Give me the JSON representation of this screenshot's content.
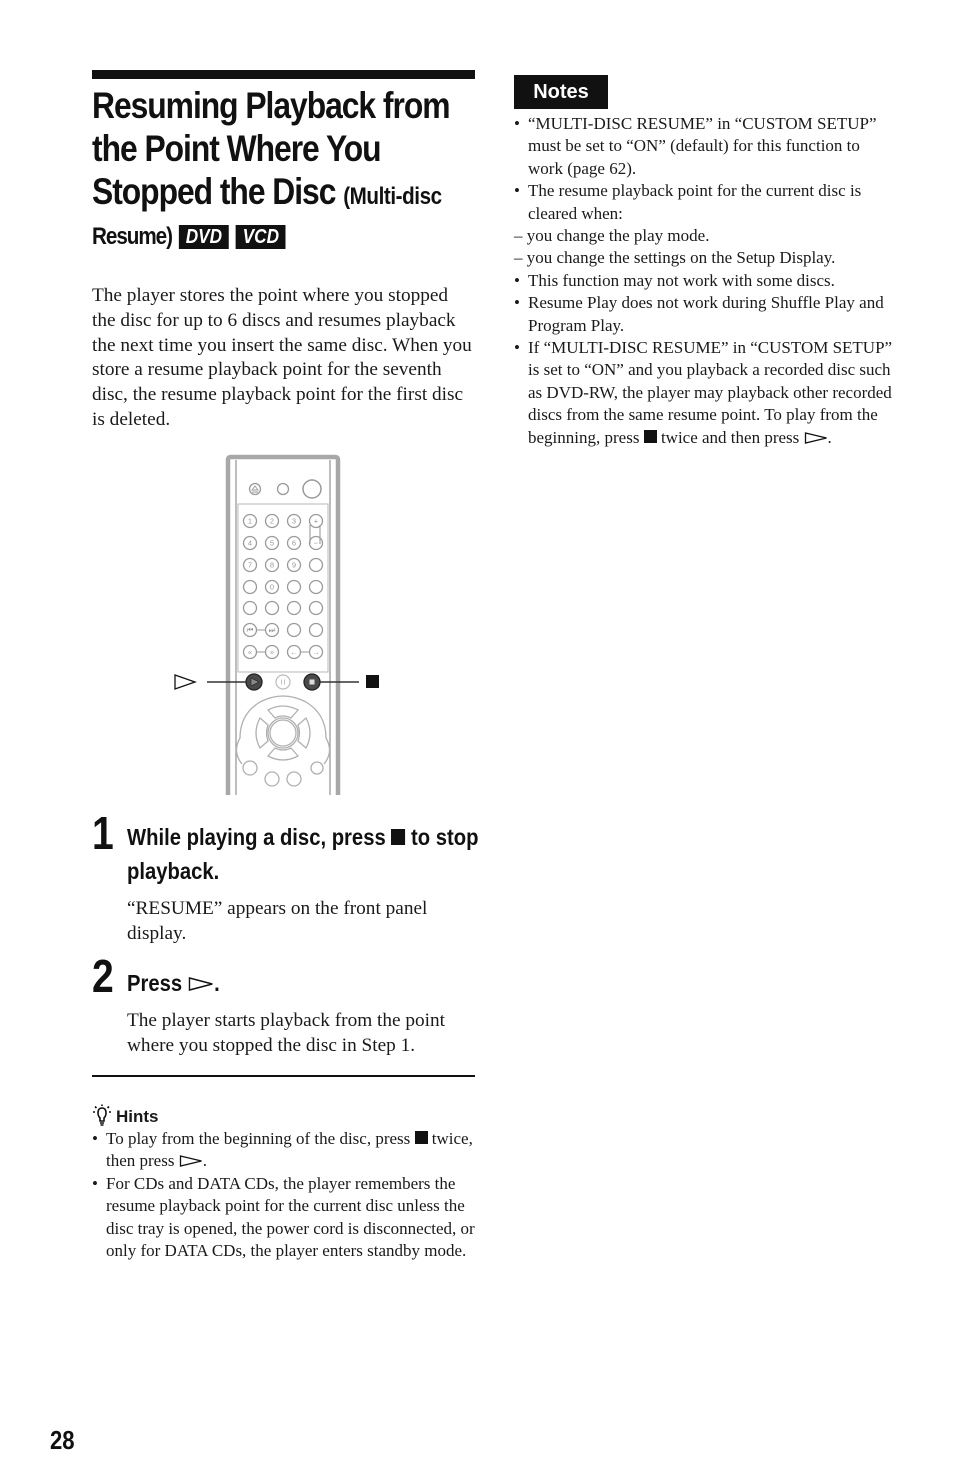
{
  "page": {
    "number": "28"
  },
  "title": {
    "line1": "Resuming Playback from",
    "line2": "the Point Where You",
    "line3_main": "Stopped the Disc",
    "line3_sub": "(Multi-disc",
    "line4_sub": "Resume)",
    "badges": [
      "DVD",
      "VCD"
    ]
  },
  "intro": "The player stores the point where you stopped the disc for up to 6 discs and resumes playback the next time you insert the same disc. When you store a resume playback point for the seventh disc, the resume playback point for the first disc is deleted.",
  "illustration": {
    "icons": [
      "remote-control",
      "play-button-callout",
      "stop-button-callout"
    ]
  },
  "steps": [
    {
      "number": "1",
      "heading_before": "While playing a disc, press",
      "heading_icon": "stop-icon",
      "heading_after": "to stop playback.",
      "body": "“RESUME” appears on the front panel display."
    },
    {
      "number": "2",
      "heading_before": "Press",
      "heading_icon": "play-icon",
      "heading_after": ".",
      "body": "The player starts playback from the point where you stopped the disc in Step 1."
    }
  ],
  "hints": {
    "title": "Hints",
    "items": [
      {
        "type": "bullet",
        "before": "To play from the beginning of the disc, press",
        "middle": "twice, then press",
        "after": "."
      },
      {
        "type": "bullet",
        "text": "For CDs and DATA CDs, the player remembers the resume playback point for the current disc unless the disc tray is opened, the power cord is disconnected, or only for DATA CDs, the player enters standby mode."
      }
    ]
  },
  "notes": {
    "title": "Notes",
    "items": [
      {
        "type": "bullet",
        "text": "“MULTI-DISC RESUME” in “CUSTOM SETUP” must be set to “ON” (default) for this function to work (page 62)."
      },
      {
        "type": "bullet",
        "text": "The resume playback point for the current disc is cleared when:"
      },
      {
        "type": "dash",
        "text": "– you change the play mode."
      },
      {
        "type": "dash",
        "text": "– you change the settings on the Setup Display."
      },
      {
        "type": "bullet",
        "text": "This function may not work with some discs."
      },
      {
        "type": "bullet",
        "text": "Resume Play does not work during Shuffle Play and Program Play."
      },
      {
        "type": "bullet",
        "text": "If “MULTI-DISC RESUME” in “CUSTOM SETUP” is set to “ON” and you playback a recorded disc such as DVD-RW, the player may playback other recorded discs from the same resume point. To play from the beginning, press",
        "middle": "twice and then press",
        "after": "."
      }
    ]
  }
}
